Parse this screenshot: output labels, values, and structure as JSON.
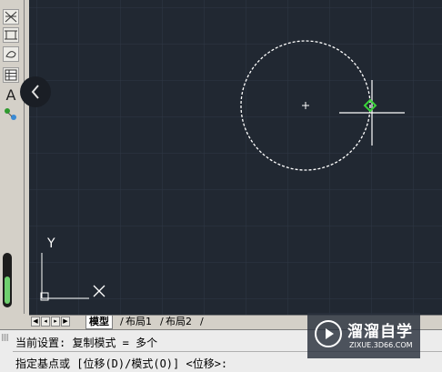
{
  "toolbar": {
    "icons": [
      "trim-icon",
      "extend-icon",
      "region-icon",
      "table-icon",
      "text-icon",
      "nodes-icon"
    ],
    "text_tool_label": "A"
  },
  "canvas": {
    "background": "#212832",
    "ucs": {
      "y_label": "Y",
      "x_label": "X"
    }
  },
  "tabs": {
    "model": "模型",
    "layout1": "布局1",
    "layout2": "布局2"
  },
  "command": {
    "line1": "当前设置:  复制模式 = 多个",
    "line2": "指定基点或 [位移(D)/模式(O)] <位移>:"
  },
  "watermark": {
    "title": "溜溜自学",
    "url": "ZIXUE.3D66.COM"
  },
  "colors": {
    "grip": "#3ad43a",
    "slider": "#6fd06f"
  }
}
